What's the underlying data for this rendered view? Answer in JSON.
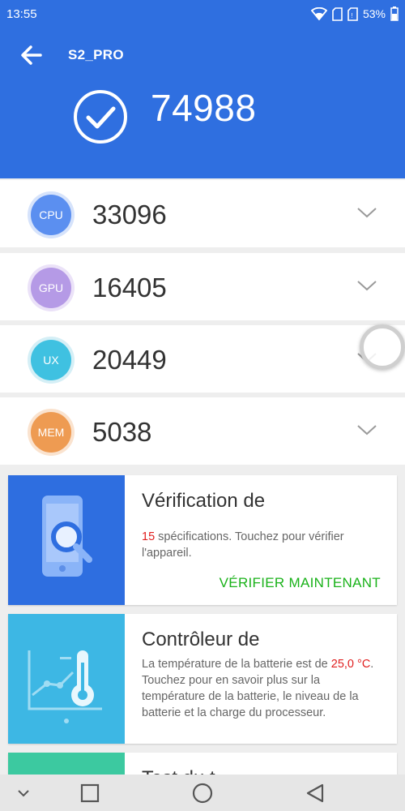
{
  "status_bar": {
    "time": "13:55",
    "battery": "53%"
  },
  "app_bar": {
    "title": "S2_PRO"
  },
  "total": {
    "score": "74988"
  },
  "scores": [
    {
      "badge": "CPU",
      "value": "33096",
      "color": "#5b8ff0",
      "ring": "#d6e3fb"
    },
    {
      "badge": "GPU",
      "value": "16405",
      "color": "#b59ae6",
      "ring": "#ebe2f8"
    },
    {
      "badge": "UX",
      "value": "20449",
      "color": "#3fc1e1",
      "ring": "#d5eff6"
    },
    {
      "badge": "MEM",
      "value": "5038",
      "color": "#ee9b52",
      "ring": "#fae3cf"
    }
  ],
  "cards": {
    "verify": {
      "title": "Vérification de",
      "desc_count": "15",
      "desc_rest": " spécifications. Touchez pour vérifier l'appareil.",
      "action": "VÉRIFIER MAINTENANT",
      "icon_bg": "#2e6ee0"
    },
    "battery": {
      "title": "Contrôleur de",
      "desc_before": "La température de la batterie est de ",
      "desc_temp": "25,0 °C",
      "desc_after": ". Touchez pour en savoir plus sur la température de la batterie, le niveau de la batterie et la charge du processeur.",
      "icon_bg": "#3db7e4"
    },
    "third": {
      "title": "Test du t",
      "icon_bg": "#3cc9a0"
    }
  },
  "colors": {
    "header": "#2f6fe0",
    "action_green": "#19b219",
    "highlight_red": "#e02020"
  },
  "icons": [
    "wifi-icon",
    "sim-icon",
    "battery-icon",
    "back-arrow-icon",
    "check-circle-icon",
    "chevron-down-icon",
    "phone-search-icon",
    "thermometer-chart-icon",
    "nav-collapse-icon",
    "nav-recents-icon",
    "nav-home-icon",
    "nav-back-icon"
  ]
}
